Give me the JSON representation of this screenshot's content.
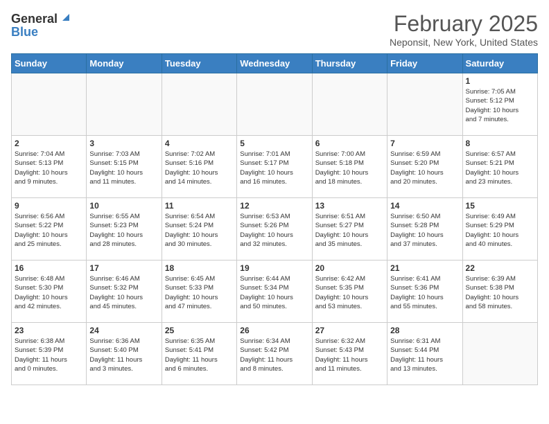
{
  "header": {
    "logo_general": "General",
    "logo_blue": "Blue",
    "month": "February 2025",
    "location": "Neponsit, New York, United States"
  },
  "days_of_week": [
    "Sunday",
    "Monday",
    "Tuesday",
    "Wednesday",
    "Thursday",
    "Friday",
    "Saturday"
  ],
  "weeks": [
    [
      {
        "day": "",
        "info": ""
      },
      {
        "day": "",
        "info": ""
      },
      {
        "day": "",
        "info": ""
      },
      {
        "day": "",
        "info": ""
      },
      {
        "day": "",
        "info": ""
      },
      {
        "day": "",
        "info": ""
      },
      {
        "day": "1",
        "info": "Sunrise: 7:05 AM\nSunset: 5:12 PM\nDaylight: 10 hours\nand 7 minutes."
      }
    ],
    [
      {
        "day": "2",
        "info": "Sunrise: 7:04 AM\nSunset: 5:13 PM\nDaylight: 10 hours\nand 9 minutes."
      },
      {
        "day": "3",
        "info": "Sunrise: 7:03 AM\nSunset: 5:15 PM\nDaylight: 10 hours\nand 11 minutes."
      },
      {
        "day": "4",
        "info": "Sunrise: 7:02 AM\nSunset: 5:16 PM\nDaylight: 10 hours\nand 14 minutes."
      },
      {
        "day": "5",
        "info": "Sunrise: 7:01 AM\nSunset: 5:17 PM\nDaylight: 10 hours\nand 16 minutes."
      },
      {
        "day": "6",
        "info": "Sunrise: 7:00 AM\nSunset: 5:18 PM\nDaylight: 10 hours\nand 18 minutes."
      },
      {
        "day": "7",
        "info": "Sunrise: 6:59 AM\nSunset: 5:20 PM\nDaylight: 10 hours\nand 20 minutes."
      },
      {
        "day": "8",
        "info": "Sunrise: 6:57 AM\nSunset: 5:21 PM\nDaylight: 10 hours\nand 23 minutes."
      }
    ],
    [
      {
        "day": "9",
        "info": "Sunrise: 6:56 AM\nSunset: 5:22 PM\nDaylight: 10 hours\nand 25 minutes."
      },
      {
        "day": "10",
        "info": "Sunrise: 6:55 AM\nSunset: 5:23 PM\nDaylight: 10 hours\nand 28 minutes."
      },
      {
        "day": "11",
        "info": "Sunrise: 6:54 AM\nSunset: 5:24 PM\nDaylight: 10 hours\nand 30 minutes."
      },
      {
        "day": "12",
        "info": "Sunrise: 6:53 AM\nSunset: 5:26 PM\nDaylight: 10 hours\nand 32 minutes."
      },
      {
        "day": "13",
        "info": "Sunrise: 6:51 AM\nSunset: 5:27 PM\nDaylight: 10 hours\nand 35 minutes."
      },
      {
        "day": "14",
        "info": "Sunrise: 6:50 AM\nSunset: 5:28 PM\nDaylight: 10 hours\nand 37 minutes."
      },
      {
        "day": "15",
        "info": "Sunrise: 6:49 AM\nSunset: 5:29 PM\nDaylight: 10 hours\nand 40 minutes."
      }
    ],
    [
      {
        "day": "16",
        "info": "Sunrise: 6:48 AM\nSunset: 5:30 PM\nDaylight: 10 hours\nand 42 minutes."
      },
      {
        "day": "17",
        "info": "Sunrise: 6:46 AM\nSunset: 5:32 PM\nDaylight: 10 hours\nand 45 minutes."
      },
      {
        "day": "18",
        "info": "Sunrise: 6:45 AM\nSunset: 5:33 PM\nDaylight: 10 hours\nand 47 minutes."
      },
      {
        "day": "19",
        "info": "Sunrise: 6:44 AM\nSunset: 5:34 PM\nDaylight: 10 hours\nand 50 minutes."
      },
      {
        "day": "20",
        "info": "Sunrise: 6:42 AM\nSunset: 5:35 PM\nDaylight: 10 hours\nand 53 minutes."
      },
      {
        "day": "21",
        "info": "Sunrise: 6:41 AM\nSunset: 5:36 PM\nDaylight: 10 hours\nand 55 minutes."
      },
      {
        "day": "22",
        "info": "Sunrise: 6:39 AM\nSunset: 5:38 PM\nDaylight: 10 hours\nand 58 minutes."
      }
    ],
    [
      {
        "day": "23",
        "info": "Sunrise: 6:38 AM\nSunset: 5:39 PM\nDaylight: 11 hours\nand 0 minutes."
      },
      {
        "day": "24",
        "info": "Sunrise: 6:36 AM\nSunset: 5:40 PM\nDaylight: 11 hours\nand 3 minutes."
      },
      {
        "day": "25",
        "info": "Sunrise: 6:35 AM\nSunset: 5:41 PM\nDaylight: 11 hours\nand 6 minutes."
      },
      {
        "day": "26",
        "info": "Sunrise: 6:34 AM\nSunset: 5:42 PM\nDaylight: 11 hours\nand 8 minutes."
      },
      {
        "day": "27",
        "info": "Sunrise: 6:32 AM\nSunset: 5:43 PM\nDaylight: 11 hours\nand 11 minutes."
      },
      {
        "day": "28",
        "info": "Sunrise: 6:31 AM\nSunset: 5:44 PM\nDaylight: 11 hours\nand 13 minutes."
      },
      {
        "day": "",
        "info": ""
      }
    ]
  ]
}
